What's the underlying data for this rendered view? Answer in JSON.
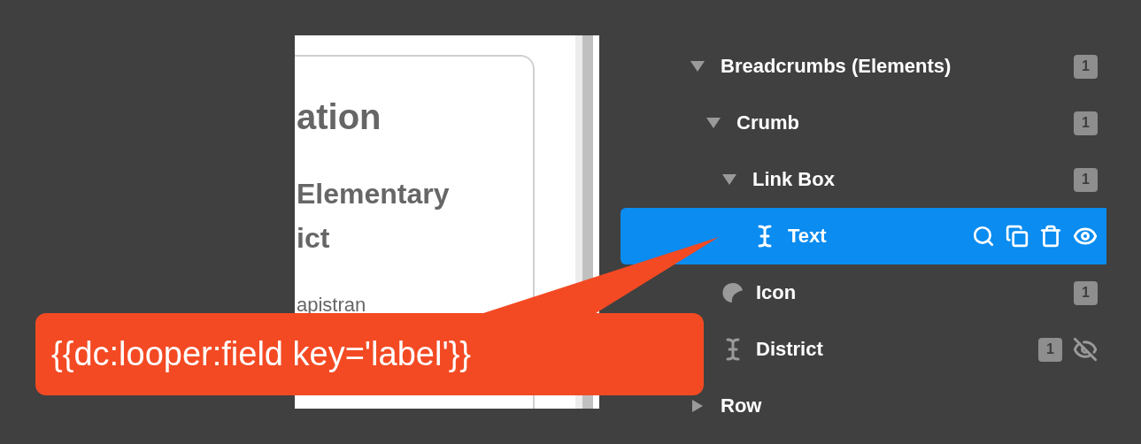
{
  "preview": {
    "heading": "ation",
    "school_lines": [
      "Elementary",
      "ict"
    ],
    "address": "apistran"
  },
  "layers": [
    {
      "label": "Breadcrumbs (Elements)",
      "kind": "group",
      "expanded": true,
      "count": "1",
      "selected": false,
      "hidden": false,
      "children": [
        {
          "label": "Crumb",
          "kind": "group",
          "expanded": true,
          "count": "1",
          "selected": false,
          "hidden": false,
          "children": [
            {
              "label": "Link Box",
              "kind": "group",
              "expanded": true,
              "count": "1",
              "selected": false,
              "hidden": false,
              "children": [
                {
                  "label": "Text",
                  "kind": "text",
                  "selected": true,
                  "hidden": false
                }
              ]
            },
            {
              "label": "Icon",
              "kind": "icon",
              "count": "1",
              "selected": false,
              "hidden": false
            },
            {
              "label": "District",
              "kind": "text",
              "count": "1",
              "selected": false,
              "hidden": true
            }
          ]
        }
      ]
    },
    {
      "label": "Row",
      "kind": "group",
      "expanded": false,
      "selected": false,
      "hidden": false
    }
  ],
  "callout": {
    "text": "{{dc:looper:field key='label'}}"
  }
}
